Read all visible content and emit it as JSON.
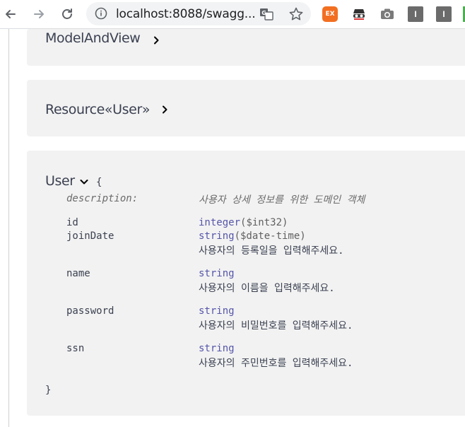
{
  "browser": {
    "url": "localhost:8088/swagg...",
    "ext_ex_label": "EX",
    "ext_i1_label": "I",
    "ext_i2_label": "I"
  },
  "models": {
    "model_and_view": {
      "title": "ModelAndView"
    },
    "resource_user": {
      "title": "Resource«User»"
    },
    "user": {
      "title": "User",
      "open_brace": "{",
      "close_brace": "}",
      "description_label": "description:",
      "description": "사용자 상세 정보를 위한 도메인 객체",
      "properties": [
        {
          "name": "id",
          "type": "integer",
          "format": "($int32)",
          "description": ""
        },
        {
          "name": "joinDate",
          "type": "string",
          "format": "($date-time)",
          "description": "사용자의 등록일을 입력해주세요."
        },
        {
          "name": "name",
          "type": "string",
          "format": "",
          "description": "사용자의 이름을 입력해주세요."
        },
        {
          "name": "password",
          "type": "string",
          "format": "",
          "description": "사용자의 비밀번호를 입력해주세요."
        },
        {
          "name": "ssn",
          "type": "string",
          "format": "",
          "description": "사용자의 주민번호를 입력해주세요."
        }
      ]
    }
  }
}
